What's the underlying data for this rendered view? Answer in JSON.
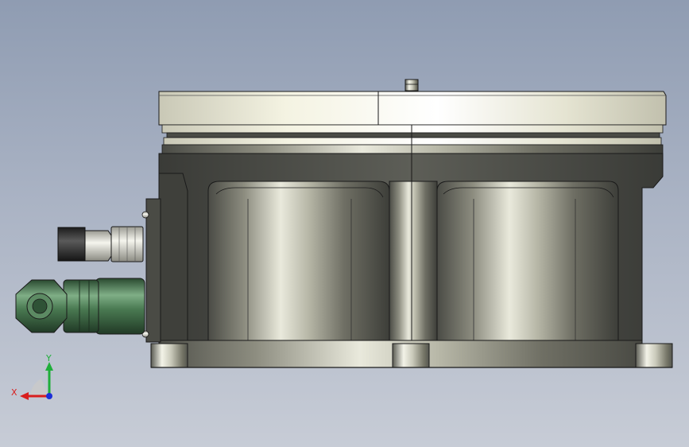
{
  "viewport": {
    "background_top": "#8f9cb2",
    "background_bottom": "#c7ccd6"
  },
  "triad": {
    "x_label": "X",
    "y_label": "Y",
    "x_color": "#d81e1e",
    "y_color": "#1fae3a",
    "z_color": "#1b2fd8"
  },
  "colors": {
    "flange": "#ecebd8",
    "body_metal": "#a9a99c",
    "fitting_green": "#3f6e47",
    "fitting_black": "#2a2a2a",
    "outline": "#1a1a1a"
  }
}
